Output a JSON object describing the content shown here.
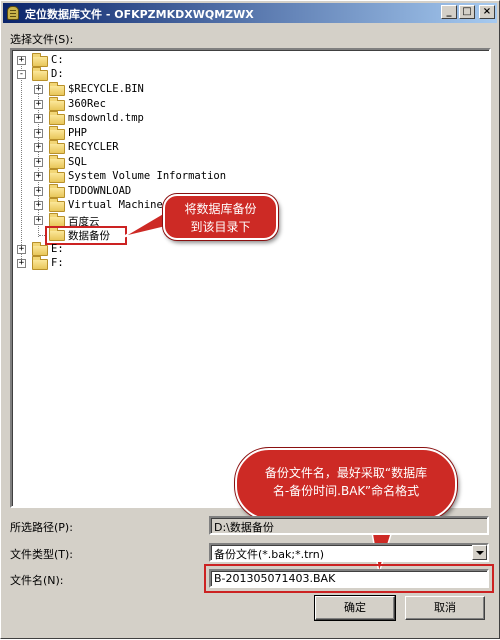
{
  "window": {
    "title": "定位数据库文件 - OFKPZMKDXWQMZWX"
  },
  "title_buttons": {
    "minimize": "_",
    "maximize": "□",
    "close": "×"
  },
  "select_label": "选择文件(S):",
  "tree": [
    {
      "label": "C:",
      "expander": "+"
    },
    {
      "label": "D:",
      "expander": "-"
    },
    {
      "label": "$RECYCLE.BIN",
      "expander": "+"
    },
    {
      "label": "360Rec",
      "expander": "+"
    },
    {
      "label": "msdownld.tmp",
      "expander": "+"
    },
    {
      "label": "PHP",
      "expander": "+"
    },
    {
      "label": "RECYCLER",
      "expander": "+"
    },
    {
      "label": "SQL",
      "expander": "+"
    },
    {
      "label": "System Volume Information",
      "expander": "+"
    },
    {
      "label": "TDDOWNLOAD",
      "expander": "+"
    },
    {
      "label": "Virtual Machines",
      "expander": "+"
    },
    {
      "label": "百度云",
      "expander": "+"
    },
    {
      "label": "数据备份",
      "expander": ""
    },
    {
      "label": "E:",
      "expander": "+"
    },
    {
      "label": "F:",
      "expander": "+"
    }
  ],
  "callouts": {
    "move_backup": [
      "将数据库备份",
      "到该目录下"
    ],
    "filename_hint": [
      "备份文件名，最好采取“数据库",
      "名-备份时间.BAK”命名格式"
    ]
  },
  "path": {
    "label": "所选路径(P):",
    "value": "D:\\数据备份"
  },
  "filetype": {
    "label": "文件类型(T):",
    "value": "备份文件(*.bak;*.trn)"
  },
  "filename": {
    "label": "文件名(N):",
    "value": "B-201305071403.BAK"
  },
  "buttons": {
    "ok": "确定",
    "cancel": "取消"
  },
  "colors": {
    "callout": "#cd2a25",
    "highlight_border": "#cc2222",
    "titlebar": "#0a246a"
  }
}
